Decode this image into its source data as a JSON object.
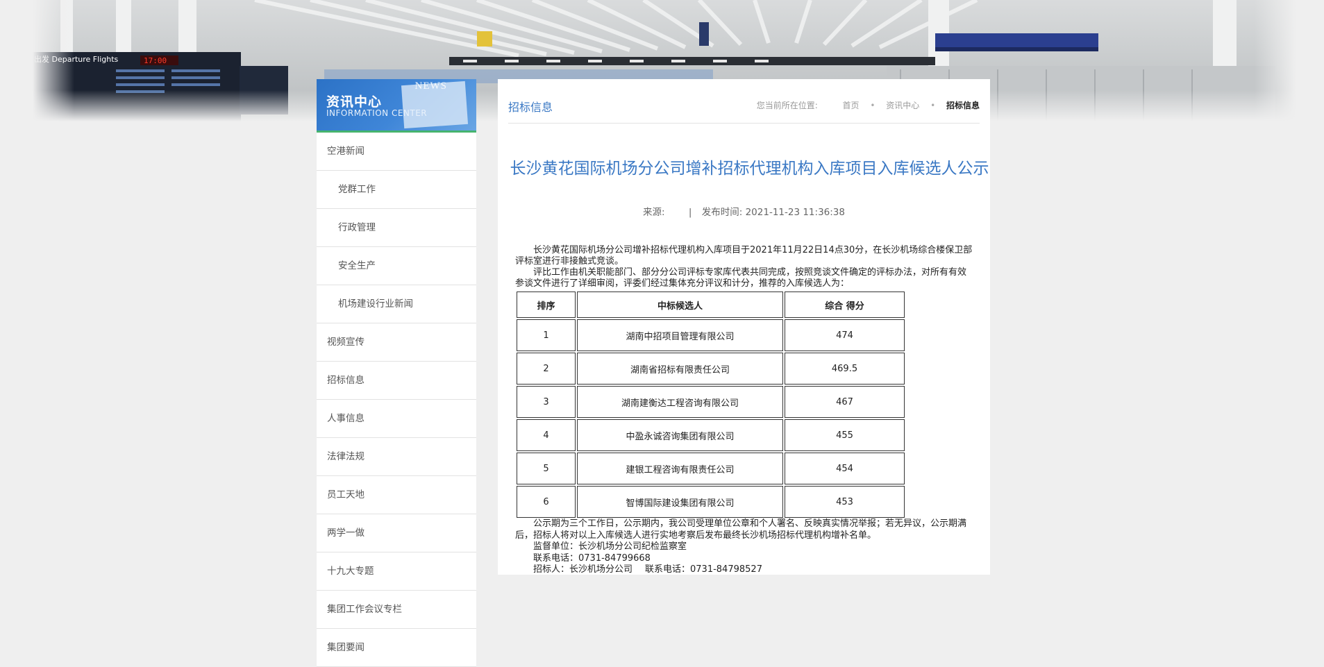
{
  "sidebar": {
    "title": "资讯中心",
    "subtitle": "INFORMATION CENTER",
    "banner_word": "NEWS",
    "items": [
      {
        "label": "空港新闻",
        "sub": false
      },
      {
        "label": "党群工作",
        "sub": true
      },
      {
        "label": "行政管理",
        "sub": true
      },
      {
        "label": "安全生产",
        "sub": true
      },
      {
        "label": "机场建设行业新闻",
        "sub": true
      },
      {
        "label": "视频宣传",
        "sub": false
      },
      {
        "label": "招标信息",
        "sub": false
      },
      {
        "label": "人事信息",
        "sub": false
      },
      {
        "label": "法律法规",
        "sub": false
      },
      {
        "label": "员工天地",
        "sub": false
      },
      {
        "label": "两学一做",
        "sub": false
      },
      {
        "label": "十九大专题",
        "sub": false
      },
      {
        "label": "集团工作会议专栏",
        "sub": false
      },
      {
        "label": "集团要闻",
        "sub": false
      }
    ]
  },
  "header": {
    "section_title": "招标信息",
    "breadcrumb_prefix": "您当前所在位置:",
    "breadcrumb": [
      "首页",
      "资讯中心",
      "招标信息"
    ]
  },
  "banner": {
    "departure_text": "出发 Departure Flights",
    "clock_text": "17:00"
  },
  "article": {
    "title": "长沙黄花国际机场分公司增补招标代理机构入库项目入库候选人公示",
    "source_label": "来源:",
    "publish_label": "发布时间:",
    "publish_time": "2021-11-23 11:36:38",
    "para1": "长沙黄花国际机场分公司增补招标代理机构入库项目于2021年11月22日14点30分，在长沙机场综合楼保卫部评标室进行非接触式竞谈。",
    "para2": "评比工作由机关职能部门、部分分公司评标专家库代表共同完成，按照竞谈文件确定的评标办法，对所有有效参谈文件进行了详细审阅，评委们经过集体充分评议和计分，推荐的入库候选人为：",
    "table": {
      "headers": [
        "排序",
        "中标候选人",
        "综合  得分"
      ],
      "rows": [
        [
          "1",
          "湖南中招项目管理有限公司",
          "474"
        ],
        [
          "2",
          "湖南省招标有限责任公司",
          "469.5"
        ],
        [
          "3",
          "湖南建衡达工程咨询有限公司",
          "467"
        ],
        [
          "4",
          "中盈永诚咨询集团有限公司",
          "455"
        ],
        [
          "5",
          "建银工程咨询有限责任公司",
          "454"
        ],
        [
          "6",
          "智博国际建设集团有限公司",
          "453"
        ]
      ]
    },
    "para3": "公示期为三个工作日，公示期内，我公司受理单位公章和个人署名、反映真实情况举报；若无异议，公示期满后，招标人将对以上入库候选人进行实地考察后发布最终长沙机场招标代理机构增补名单。",
    "supervisor": "监督单位：长沙机场分公司纪检监察室",
    "supervisor_phone": "联系电话：0731-84799668",
    "tenderer": "招标人：长沙机场分公司",
    "tenderer_phone": "联系电话：0731-84798527"
  }
}
